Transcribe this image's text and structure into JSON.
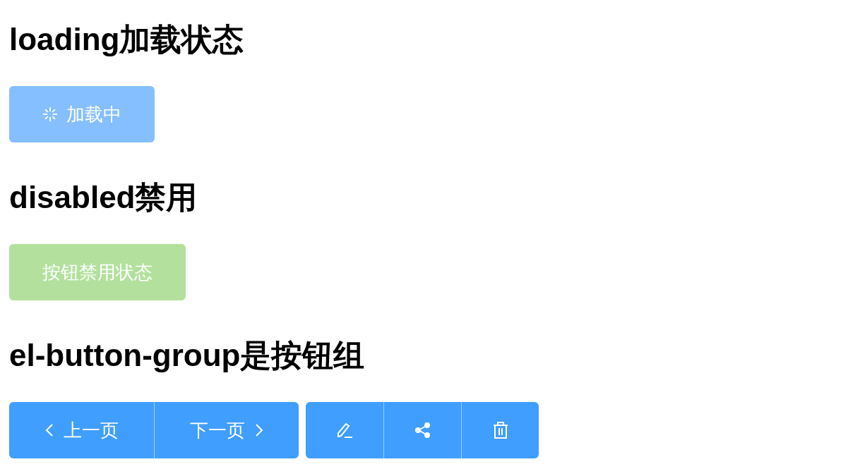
{
  "sections": [
    {
      "heading": "loading加载状态",
      "buttons": [
        {
          "kind": "primary",
          "label": "加载中",
          "loading": true
        }
      ]
    },
    {
      "heading": "disabled禁用",
      "buttons": [
        {
          "kind": "success",
          "label": "按钮禁用状态",
          "disabled": true
        }
      ]
    },
    {
      "heading": "el-button-group是按钮组",
      "groups": [
        [
          {
            "kind": "prev",
            "label": "上一页"
          },
          {
            "kind": "next",
            "label": "下一页"
          }
        ],
        [
          {
            "kind": "edit"
          },
          {
            "kind": "share"
          },
          {
            "kind": "delete"
          }
        ]
      ]
    }
  ]
}
